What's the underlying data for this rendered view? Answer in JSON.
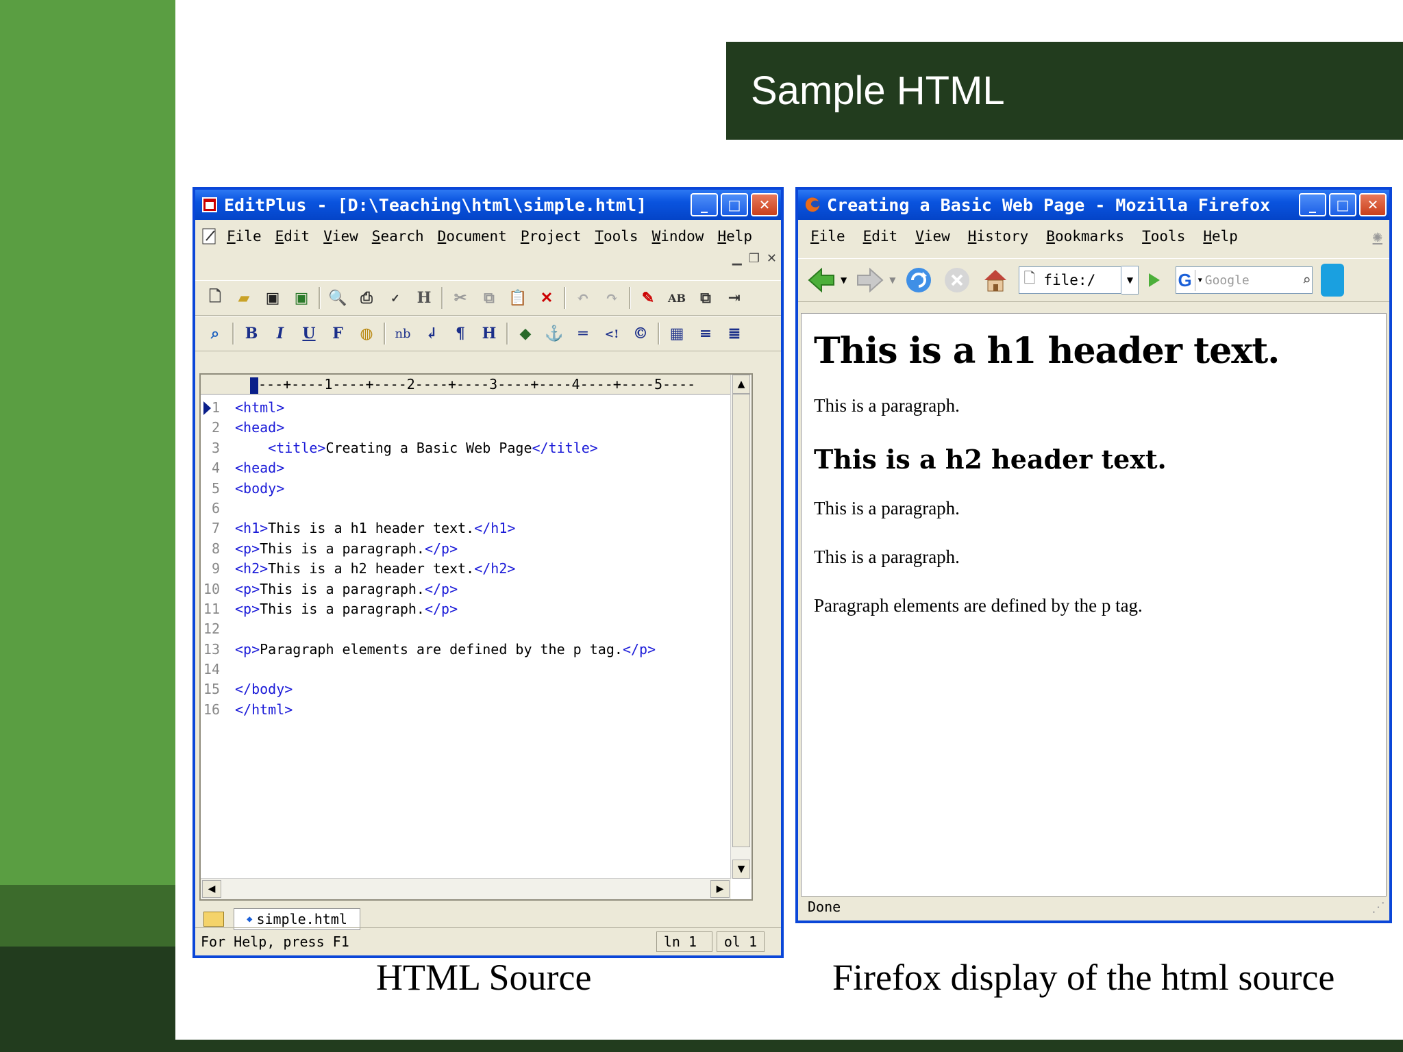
{
  "slide": {
    "title": "Sample HTML",
    "caption_left": "HTML Source",
    "caption_right": "Firefox display of the html source"
  },
  "editplus": {
    "title": "EditPlus - [D:\\Teaching\\html\\simple.html]",
    "menu": [
      "File",
      "Edit",
      "View",
      "Search",
      "Document",
      "Project",
      "Tools",
      "Window",
      "Help"
    ],
    "ruler": "---+----1----+----2----+----3----+----4----+----5----",
    "code_lines": [
      {
        "n": "1",
        "pre": "",
        "parts": [
          [
            "t",
            "<html>"
          ]
        ]
      },
      {
        "n": "2",
        "pre": "",
        "parts": [
          [
            "t",
            "<head>"
          ]
        ]
      },
      {
        "n": "3",
        "pre": "    ",
        "parts": [
          [
            "t",
            "<title>"
          ],
          [
            "x",
            "Creating a Basic Web Page"
          ],
          [
            "t",
            "</title>"
          ]
        ]
      },
      {
        "n": "4",
        "pre": "",
        "parts": [
          [
            "t",
            "<head>"
          ]
        ]
      },
      {
        "n": "5",
        "pre": "",
        "parts": [
          [
            "t",
            "<body>"
          ]
        ]
      },
      {
        "n": "6",
        "pre": "",
        "parts": []
      },
      {
        "n": "7",
        "pre": "",
        "parts": [
          [
            "t",
            "<h1>"
          ],
          [
            "x",
            "This is a h1 header text."
          ],
          [
            "t",
            "</h1>"
          ]
        ]
      },
      {
        "n": "8",
        "pre": "",
        "parts": [
          [
            "t",
            "<p>"
          ],
          [
            "x",
            "This is a paragraph."
          ],
          [
            "t",
            "</p>"
          ]
        ]
      },
      {
        "n": "9",
        "pre": "",
        "parts": [
          [
            "t",
            "<h2>"
          ],
          [
            "x",
            "This is a h2 header text."
          ],
          [
            "t",
            "</h2>"
          ]
        ]
      },
      {
        "n": "10",
        "pre": "",
        "parts": [
          [
            "t",
            "<p>"
          ],
          [
            "x",
            "This is a paragraph."
          ],
          [
            "t",
            "</p>"
          ]
        ]
      },
      {
        "n": "11",
        "pre": "",
        "parts": [
          [
            "t",
            "<p>"
          ],
          [
            "x",
            "This is a paragraph."
          ],
          [
            "t",
            "</p>"
          ]
        ]
      },
      {
        "n": "12",
        "pre": "",
        "parts": []
      },
      {
        "n": "13",
        "pre": "",
        "parts": [
          [
            "t",
            "<p>"
          ],
          [
            "x",
            "Paragraph elements are defined by the p tag."
          ],
          [
            "t",
            "</p>"
          ]
        ]
      },
      {
        "n": "14",
        "pre": "",
        "parts": []
      },
      {
        "n": "15",
        "pre": "",
        "parts": [
          [
            "t",
            "</body>"
          ]
        ]
      },
      {
        "n": "16",
        "pre": "",
        "parts": [
          [
            "t",
            "</html>"
          ]
        ]
      }
    ],
    "file_tab": "simple.html",
    "status_help": "For Help, press F1",
    "status_ln": "ln 1",
    "status_col": "ol 1"
  },
  "firefox": {
    "title": "Creating a Basic Web Page - Mozilla Firefox",
    "menu": [
      "File",
      "Edit",
      "View",
      "History",
      "Bookmarks",
      "Tools",
      "Help"
    ],
    "url": "file:/",
    "search_placeholder": "Google",
    "content": {
      "h1": "This is a h1 header text.",
      "p1": "This is a paragraph.",
      "h2": "This is a h2 header text.",
      "p2": "This is a paragraph.",
      "p3": "This is a paragraph.",
      "p4": "Paragraph elements are defined by the p tag."
    },
    "status": "Done"
  },
  "colors": {
    "side_green": "#5a9e42",
    "dark_green": "#223c1e",
    "xp_blue": "#0a46d8",
    "tag_blue": "#1a1ad8"
  }
}
